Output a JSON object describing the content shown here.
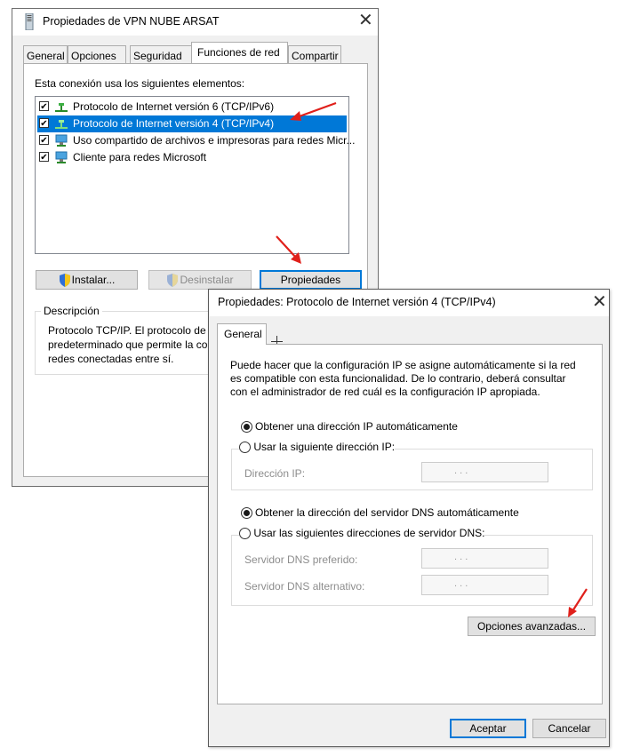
{
  "dialog1": {
    "title": "Propiedades de VPN NUBE ARSAT",
    "tabs": [
      "General",
      "Opciones",
      "Seguridad",
      "Funciones de red",
      "Compartir"
    ],
    "active_tab": "Funciones de red",
    "connection_label": "Esta conexión usa los siguientes elementos:",
    "items": [
      {
        "label": "Protocolo de Internet versión 6 (TCP/IPv6)",
        "checked": true,
        "selected": false,
        "icon": "network-protocol-icon"
      },
      {
        "label": "Protocolo de Internet versión 4 (TCP/IPv4)",
        "checked": true,
        "selected": true,
        "icon": "network-protocol-icon"
      },
      {
        "label": "Uso compartido de archivos e impresoras para redes Micr...",
        "checked": true,
        "selected": false,
        "icon": "file-printer-sharing-icon"
      },
      {
        "label": "Cliente para redes Microsoft",
        "checked": true,
        "selected": false,
        "icon": "network-client-icon"
      }
    ],
    "buttons": {
      "install": "Instalar...",
      "uninstall": "Desinstalar",
      "properties": "Propiedades"
    },
    "description": {
      "legend": "Descripción",
      "lines": [
        "Protocolo TCP/IP. El protocolo de",
        "predeterminado que permite la co",
        "redes conectadas entre sí."
      ]
    }
  },
  "dialog2": {
    "title": "Propiedades: Protocolo de Internet versión 4 (TCP/IPv4)",
    "tab": "General",
    "intro_lines": [
      "Puede hacer que la configuración IP se asigne automáticamente si la red",
      "es compatible con esta funcionalidad. De lo contrario, deberá consultar",
      "con el administrador de red cuál es la configuración IP apropiada."
    ],
    "ip_auto": "Obtener una dirección IP automáticamente",
    "ip_manual": "Usar la siguiente dirección IP:",
    "ip_address_label": "Dirección IP:",
    "dns_auto": "Obtener la dirección del servidor DNS automáticamente",
    "dns_manual": "Usar las siguientes direcciones de servidor DNS:",
    "dns_preferred_label": "Servidor DNS preferido:",
    "dns_alternate_label": "Servidor DNS alternativo:",
    "ip_placeholder": ".       .       .",
    "advanced_button": "Opciones avanzadas...",
    "ok_button": "Aceptar",
    "cancel_button": "Cancelar",
    "ip_auto_selected": true,
    "dns_auto_selected": true
  },
  "colors": {
    "selection": "#0078d7",
    "arrow": "#e0201b",
    "dialog_bg": "#f0f0f0"
  }
}
